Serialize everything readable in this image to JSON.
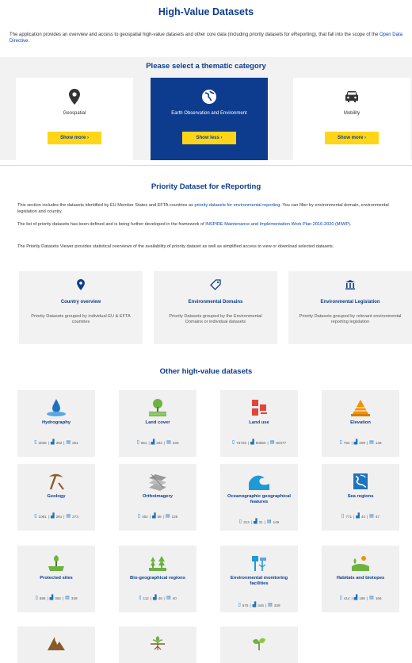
{
  "header": {
    "title": "High-Value Datasets",
    "intro_text": "The application provides an overview and access to geospatial high-value datasets and other core data (including priority datasets for eReporting), that fall into the scope of the ",
    "intro_link": "Open Data Directive",
    "intro_end": "."
  },
  "thematic": {
    "heading": "Please select a thematic category",
    "cards": [
      {
        "label": "Geospatial",
        "button": "Show more",
        "icon": "location-pin-icon"
      },
      {
        "label": "Earth Observation and Environment",
        "button": "Show less",
        "icon": "earth-globe-icon"
      },
      {
        "label": "Mobility",
        "button": "Show more",
        "icon": "car-icon"
      }
    ]
  },
  "priority": {
    "heading": "Priority Dataset for eReporting",
    "p1_text": "This section includes the datasets identified by EU Member States and EFTA countries as ",
    "p1_link": "priority datasets for environmental reporting",
    "p1_end": ". You can filter by environmental domain, environmental legislation and country.",
    "p2_text": "The list of priority datasets has been defined and is being further developed in the framework of ",
    "p2_link": "INSPIRE Maintenance and Implementation Work Plan 2016-2020 (MIWP)",
    "p2_end": ".",
    "p3_text": "The Priority Datasets Viewer provides statistical overviews of the availability of priority dataset as well as simplified access to view or download selected datasets.",
    "cards": [
      {
        "title": "Country overview",
        "desc": "Priority Datasets grouped by individual EU & EFTA countries",
        "icon": "location-pin-icon"
      },
      {
        "title": "Environmental Domains",
        "desc": "Priority Datasets grouped by the Environmental Domains or individual datasets",
        "icon": "tag-icon"
      },
      {
        "title": "Environmental Legislation",
        "desc": "Priority Datasets grouped by relevant environmental reporting legislation",
        "icon": "institution-icon"
      }
    ]
  },
  "other": {
    "heading": "Other high-value datasets",
    "cards": [
      {
        "title": "Hydrography",
        "datasets": "3026",
        "services": "392",
        "maps": "261",
        "icon": "water-drop-icon"
      },
      {
        "title": "Land cover",
        "datasets": "651",
        "services": "282",
        "maps": "233",
        "icon": "land-cover-icon"
      },
      {
        "title": "Land use",
        "datasets": "73726",
        "services": "60850",
        "maps": "60477",
        "icon": "land-use-icon"
      },
      {
        "title": "Elevation",
        "datasets": "784",
        "services": "209",
        "maps": "146",
        "icon": "elevation-icon"
      },
      {
        "title": "Geology",
        "datasets": "1051",
        "services": "281",
        "maps": "273",
        "icon": "pickaxe-icon"
      },
      {
        "title": "Orthoimagery",
        "datasets": "452",
        "services": "56",
        "maps": "125",
        "icon": "orthoimagery-icon"
      },
      {
        "title": "Oceanographic geographical features",
        "datasets": "313",
        "services": "31",
        "maps": "149",
        "icon": "wave-icon"
      },
      {
        "title": "Sea regions",
        "datasets": "771",
        "services": "44",
        "maps": "47",
        "icon": "sea-regions-icon"
      },
      {
        "title": "Protected sites",
        "datasets": "686",
        "services": "362",
        "maps": "349",
        "icon": "protected-sites-icon"
      },
      {
        "title": "Bio-geographical regions",
        "datasets": "112",
        "services": "46",
        "maps": "40",
        "icon": "bio-regions-icon"
      },
      {
        "title": "Environmental monitoring facilities",
        "datasets": "575",
        "services": "346",
        "maps": "339",
        "icon": "monitoring-facilities-icon"
      },
      {
        "title": "Habitats and biotopes",
        "datasets": "414",
        "services": "186",
        "maps": "166",
        "icon": "habitats-icon"
      }
    ],
    "partial_cards": [
      {
        "icon": "mountain-icon"
      },
      {
        "icon": "plant-roots-icon"
      },
      {
        "icon": "leaves-icon"
      }
    ]
  },
  "colors": {
    "brand_blue": "#0d3c8f",
    "accent_yellow": "#ffd617",
    "icon_blue": "#1e73be",
    "icon_green": "#6db33f",
    "icon_orange": "#f39200"
  }
}
